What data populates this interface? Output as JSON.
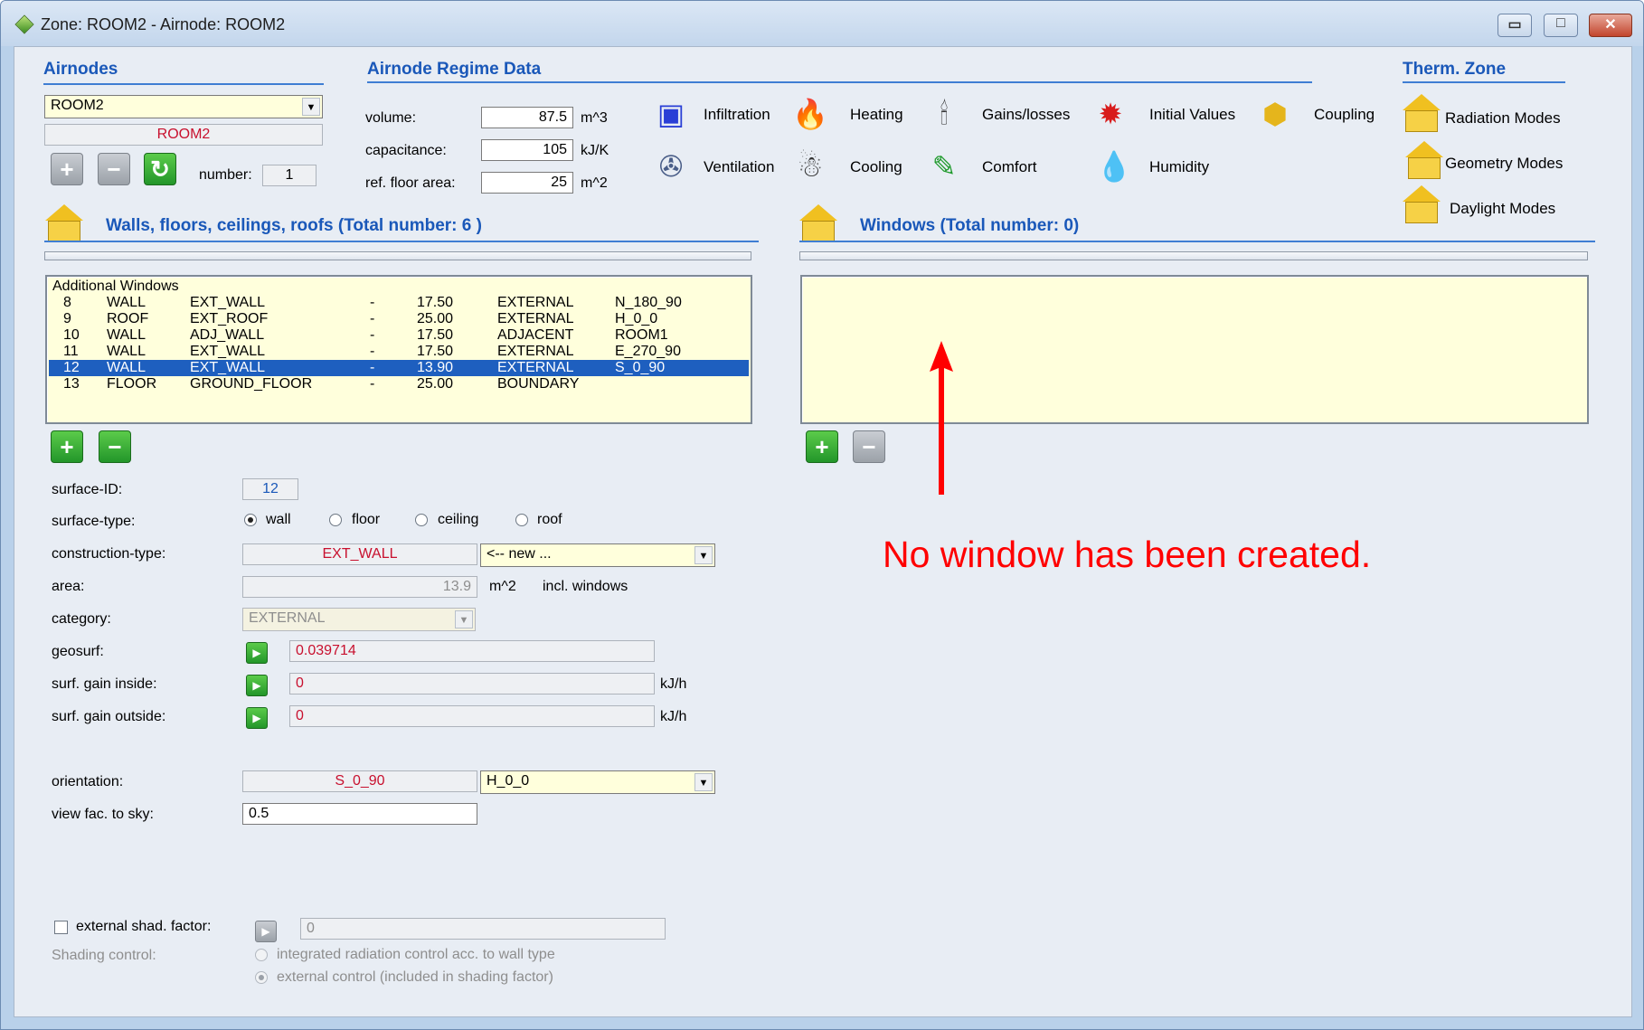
{
  "window": {
    "title": "Zone: ROOM2  -   Airnode: ROOM2"
  },
  "titlebar": {
    "minimize": "▭",
    "maximize": "□",
    "close": "✕"
  },
  "airnodes": {
    "heading": "Airnodes",
    "selected": "ROOM2",
    "name_field": "ROOM2",
    "number_label": "number:",
    "number_value": "1"
  },
  "regime": {
    "heading": "Airnode Regime Data",
    "volume_label": "volume:",
    "volume_value": "87.5",
    "volume_unit": "m^3",
    "capacitance_label": "capacitance:",
    "capacitance_value": "105",
    "capacitance_unit": "kJ/K",
    "floor_label": "ref. floor area:",
    "floor_value": "25",
    "floor_unit": "m^2",
    "icons": {
      "infiltration": "Infiltration",
      "heating": "Heating",
      "gains": "Gains/losses",
      "initial": "Initial Values",
      "coupling": "Coupling",
      "ventilation": "Ventilation",
      "cooling": "Cooling",
      "comfort": "Comfort",
      "humidity": "Humidity"
    }
  },
  "therm_zone": {
    "heading": "Therm. Zone",
    "radiation": "Radiation Modes",
    "geometry": "Geometry Modes",
    "daylight": "Daylight Modes"
  },
  "walls": {
    "heading": "Walls, floors, ceilings, roofs (Total number: 6 )",
    "group_header": "Additional Windows",
    "rows": [
      {
        "id": "8",
        "type": "WALL",
        "construction": "EXT_WALL",
        "dash": "-",
        "area": "17.50",
        "category": "EXTERNAL",
        "orientation": "N_180_90"
      },
      {
        "id": "9",
        "type": "ROOF",
        "construction": "EXT_ROOF",
        "dash": "-",
        "area": "25.00",
        "category": "EXTERNAL",
        "orientation": "H_0_0"
      },
      {
        "id": "10",
        "type": "WALL",
        "construction": "ADJ_WALL",
        "dash": "-",
        "area": "17.50",
        "category": "ADJACENT",
        "orientation": "ROOM1"
      },
      {
        "id": "11",
        "type": "WALL",
        "construction": "EXT_WALL",
        "dash": "-",
        "area": "17.50",
        "category": "EXTERNAL",
        "orientation": "E_270_90"
      },
      {
        "id": "12",
        "type": "WALL",
        "construction": "EXT_WALL",
        "dash": "-",
        "area": "13.90",
        "category": "EXTERNAL",
        "orientation": "S_0_90"
      },
      {
        "id": "13",
        "type": "FLOOR",
        "construction": "GROUND_FLOOR",
        "dash": "-",
        "area": "25.00",
        "category": "BOUNDARY",
        "orientation": ""
      }
    ],
    "selected_index": 4
  },
  "windows": {
    "heading": "Windows (Total number: 0)"
  },
  "annotation": {
    "text": "No window has been created."
  },
  "form": {
    "surface_id_label": "surface-ID:",
    "surface_id": "12",
    "surface_type_label": "surface-type:",
    "types": [
      "wall",
      "floor",
      "ceiling",
      "roof"
    ],
    "construction_label": "construction-type:",
    "construction": "EXT_WALL",
    "construction_select": "<-- new ...",
    "area_label": "area:",
    "area": "13.9",
    "area_unit": "m^2",
    "area_note": "incl. windows",
    "category_label": "category:",
    "category": "EXTERNAL",
    "geosurf_label": "geosurf:",
    "geosurf": "0.039714",
    "gain_in_label": "surf. gain inside:",
    "gain_in": "0",
    "gain_in_unit": "kJ/h",
    "gain_out_label": "surf. gain outside:",
    "gain_out": "0",
    "gain_out_unit": "kJ/h",
    "orientation_label": "orientation:",
    "orientation": "S_0_90",
    "orientation_select": "H_0_0",
    "viewfac_label": "view fac. to sky:",
    "viewfac": "0.5",
    "shad_label": "external shad. factor:",
    "shad_value": "0",
    "shading_control_label": "Shading control:",
    "shading_opt1": "integrated radiation control acc. to wall type",
    "shading_opt2": "external control (included in shading factor)"
  },
  "colors": {
    "accent": "#1a58b9",
    "annotation": "#ff0000",
    "selection": "#1e5fbf",
    "list_bg": "#ffffdc"
  }
}
